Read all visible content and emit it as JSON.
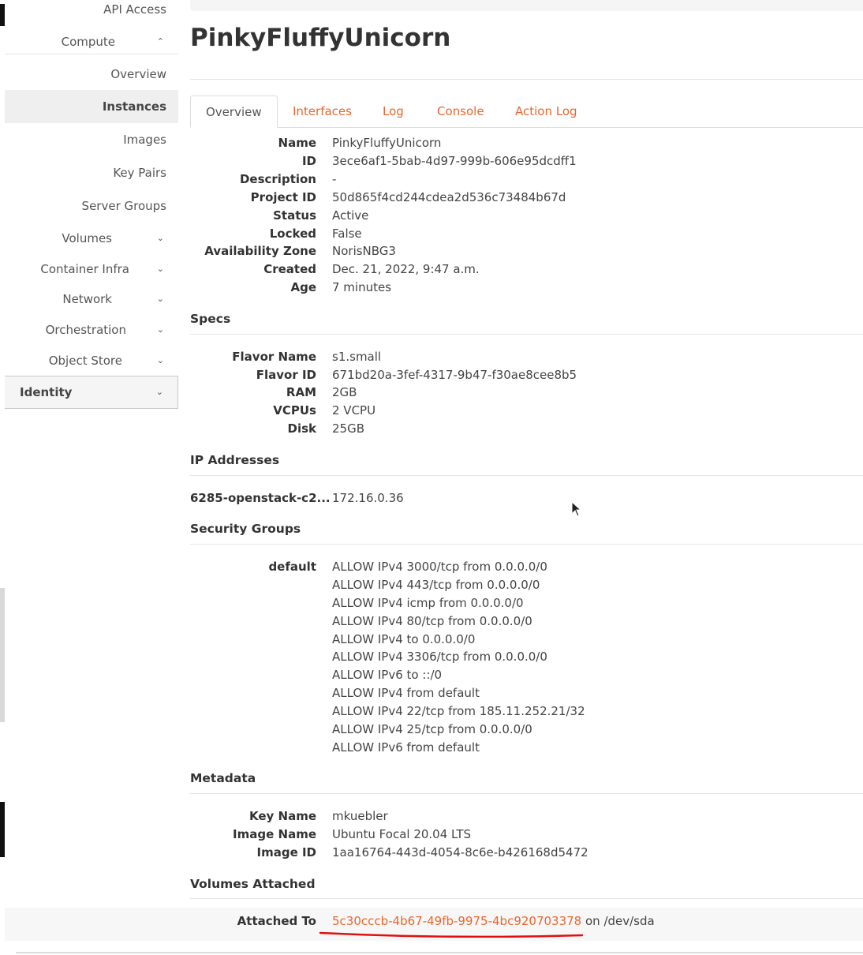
{
  "sidebar": {
    "api_access": "API Access",
    "compute": "Compute",
    "overview": "Overview",
    "instances": "Instances",
    "images": "Images",
    "key_pairs": "Key Pairs",
    "server_groups": "Server Groups",
    "volumes": "Volumes",
    "container_infra": "Container Infra",
    "network": "Network",
    "orchestration": "Orchestration",
    "object_store": "Object Store",
    "identity": "Identity"
  },
  "page": {
    "title": "PinkyFluffyUnicorn"
  },
  "tabs": [
    "Overview",
    "Interfaces",
    "Log",
    "Console",
    "Action Log"
  ],
  "overview": [
    {
      "label": "Name",
      "value": "PinkyFluffyUnicorn"
    },
    {
      "label": "ID",
      "value": "3ece6af1-5bab-4d97-999b-606e95dcdff1"
    },
    {
      "label": "Description",
      "value": "-"
    },
    {
      "label": "Project ID",
      "value": "50d865f4cd244cdea2d536c73484b67d"
    },
    {
      "label": "Status",
      "value": "Active"
    },
    {
      "label": "Locked",
      "value": "False"
    },
    {
      "label": "Availability Zone",
      "value": "NorisNBG3"
    },
    {
      "label": "Created",
      "value": "Dec. 21, 2022, 9:47 a.m."
    },
    {
      "label": "Age",
      "value": "7 minutes"
    }
  ],
  "specs": {
    "heading": "Specs",
    "rows": [
      {
        "label": "Flavor Name",
        "value": "s1.small"
      },
      {
        "label": "Flavor ID",
        "value": "671bd20a-3fef-4317-9b47-f30ae8cee8b5"
      },
      {
        "label": "RAM",
        "value": "2GB"
      },
      {
        "label": "VCPUs",
        "value": "2 VCPU"
      },
      {
        "label": "Disk",
        "value": "25GB"
      }
    ]
  },
  "ip_addresses": {
    "heading": "IP Addresses",
    "network": "6285-openstack-c2...",
    "address": "172.16.0.36"
  },
  "security_groups": {
    "heading": "Security Groups",
    "group": "default",
    "rules": [
      "ALLOW IPv4 3000/tcp from 0.0.0.0/0",
      "ALLOW IPv4 443/tcp from 0.0.0.0/0",
      "ALLOW IPv4 icmp from 0.0.0.0/0",
      "ALLOW IPv4 80/tcp from 0.0.0.0/0",
      "ALLOW IPv4 to 0.0.0.0/0",
      "ALLOW IPv4 3306/tcp from 0.0.0.0/0",
      "ALLOW IPv6 to ::/0",
      "ALLOW IPv4 from default",
      "ALLOW IPv4 22/tcp from 185.11.252.21/32",
      "ALLOW IPv4 25/tcp from 0.0.0.0/0",
      "ALLOW IPv6 from default"
    ]
  },
  "metadata": {
    "heading": "Metadata",
    "key_name_label": "Key Name",
    "key_name": "mkuebler",
    "image_name_label": "Image Name",
    "image_name": "Ubuntu Focal 20.04 LTS",
    "image_id_label": "Image ID",
    "image_id": "1aa16764-443d-4054-8c6e-b426168d5472"
  },
  "volumes": {
    "heading": "Volumes Attached",
    "attached_label": "Attached To",
    "volume_id": "5c30cccb-4b67-49fb-9975-4bc920703378",
    "mount": " on /dev/sda"
  },
  "colors": {
    "accent": "#e6672f",
    "highlight_mark": "#e01010"
  }
}
